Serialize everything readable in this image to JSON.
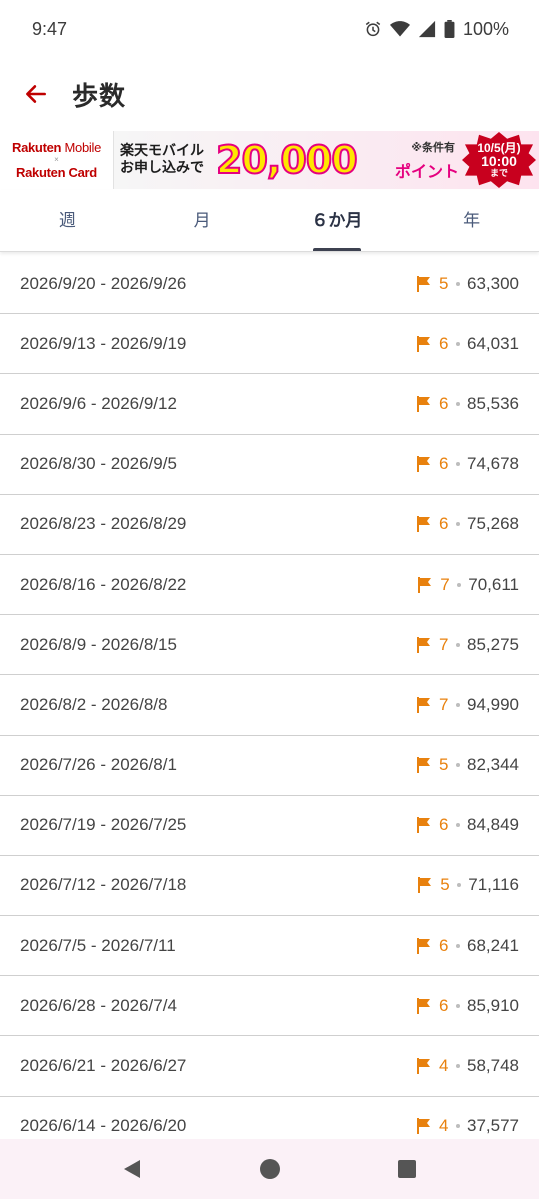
{
  "status_bar": {
    "time": "9:47",
    "battery": "100%"
  },
  "header": {
    "title": "歩数"
  },
  "banner": {
    "brand_mobile_1": "Rakuten",
    "brand_mobile_2": " Mobile",
    "brand_x": "×",
    "brand_card": "Rakuten Card",
    "text": "楽天モバイルお申し込みで",
    "amount": "20,000",
    "condition": "※条件有",
    "point": "ポイント",
    "badge_date": "10/5(月)",
    "badge_time": "10:00",
    "badge_until": "まで"
  },
  "tabs": [
    {
      "label": "週"
    },
    {
      "label": "月"
    },
    {
      "label": "６か月"
    },
    {
      "label": "年"
    }
  ],
  "active_tab": "６か月",
  "rows": [
    {
      "date": "2026/9/20 - 2026/9/26",
      "count": "5",
      "steps": "63,300"
    },
    {
      "date": "2026/9/13 - 2026/9/19",
      "count": "6",
      "steps": "64,031"
    },
    {
      "date": "2026/9/6 - 2026/9/12",
      "count": "6",
      "steps": "85,536"
    },
    {
      "date": "2026/8/30 - 2026/9/5",
      "count": "6",
      "steps": "74,678"
    },
    {
      "date": "2026/8/23 - 2026/8/29",
      "count": "6",
      "steps": "75,268"
    },
    {
      "date": "2026/8/16 - 2026/8/22",
      "count": "7",
      "steps": "70,611"
    },
    {
      "date": "2026/8/9 - 2026/8/15",
      "count": "7",
      "steps": "85,275"
    },
    {
      "date": "2026/8/2 - 2026/8/8",
      "count": "7",
      "steps": "94,990"
    },
    {
      "date": "2026/7/26 - 2026/8/1",
      "count": "5",
      "steps": "82,344"
    },
    {
      "date": "2026/7/19 - 2026/7/25",
      "count": "6",
      "steps": "84,849"
    },
    {
      "date": "2026/7/12 - 2026/7/18",
      "count": "5",
      "steps": "71,116"
    },
    {
      "date": "2026/7/5 - 2026/7/11",
      "count": "6",
      "steps": "68,241"
    },
    {
      "date": "2026/6/28 - 2026/7/4",
      "count": "6",
      "steps": "85,910"
    },
    {
      "date": "2026/6/21 - 2026/6/27",
      "count": "4",
      "steps": "58,748"
    },
    {
      "date": "2026/6/14 - 2026/6/20",
      "count": "4",
      "steps": "37,577"
    }
  ],
  "icons": {
    "back": "arrow-left-icon",
    "flag": "flag-icon",
    "nav_back": "triangle-back-icon",
    "nav_home": "circle-home-icon",
    "nav_recents": "square-recents-icon"
  },
  "colors": {
    "accent_red": "#bf0000",
    "flag_orange": "#e8810e",
    "tab_active": "#2b3245",
    "tab_inactive": "#4a5a7a"
  }
}
